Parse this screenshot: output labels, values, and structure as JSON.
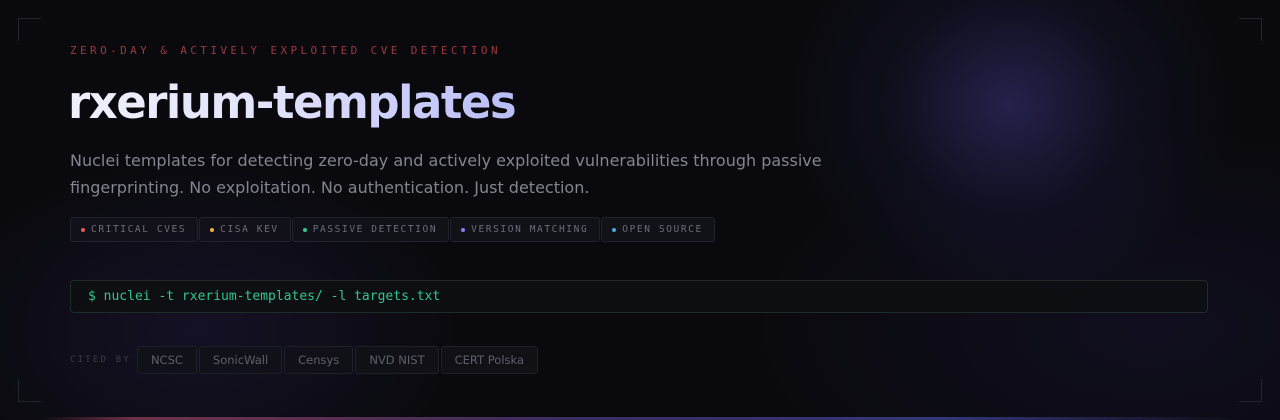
{
  "hero": {
    "eyebrow": "ZERO-DAY & ACTIVELY EXPLOITED CVE DETECTION",
    "title": "rxerium-templates",
    "subtitle": "Nuclei templates for detecting zero-day and actively exploited vulnerabilities through passive fingerprinting. No exploitation. No authentication. Just detection."
  },
  "tags": [
    {
      "label": "CRITICAL CVES",
      "color": "#e05a5a"
    },
    {
      "label": "CISA KEV",
      "color": "#e8b33a"
    },
    {
      "label": "PASSIVE DETECTION",
      "color": "#34c48e"
    },
    {
      "label": "VERSION MATCHING",
      "color": "#8b7cf0"
    },
    {
      "label": "OPEN SOURCE",
      "color": "#4aa9d8"
    }
  ],
  "command": {
    "prompt": "$",
    "text": "nuclei -t rxerium-templates/ -l targets.txt"
  },
  "cited_by": {
    "label": "CITED BY",
    "sources": [
      "NCSC",
      "SonicWall",
      "Censys",
      "NVD NIST",
      "CERT Polska"
    ]
  }
}
